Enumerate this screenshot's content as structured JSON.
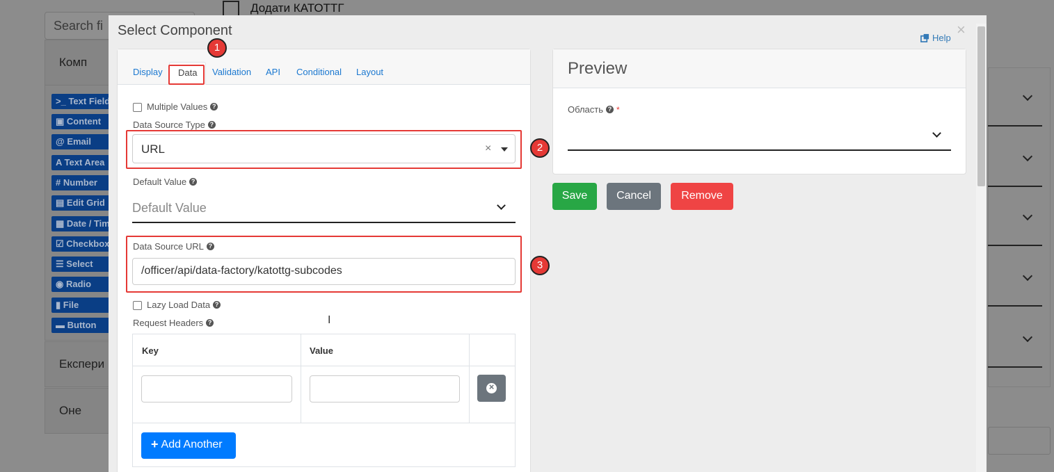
{
  "background": {
    "top_checkbox_label": "Додати КАТОТТГ",
    "search_placeholder": "Search fi",
    "groups": [
      "Комп",
      "Експери",
      "Оне"
    ],
    "components": [
      {
        "icon": ">_",
        "label": "Text Field"
      },
      {
        "icon": "▣",
        "label": "Content"
      },
      {
        "icon": "@",
        "label": "Email"
      },
      {
        "icon": "A",
        "label": "Text Area"
      },
      {
        "icon": "#",
        "label": "Number"
      },
      {
        "icon": "▤",
        "label": "Edit Grid"
      },
      {
        "icon": "▦",
        "label": "Date / Time"
      },
      {
        "icon": "☑",
        "label": "Checkbox"
      },
      {
        "icon": "☰",
        "label": "Select"
      },
      {
        "icon": "◉",
        "label": "Radio"
      },
      {
        "icon": "▮",
        "label": "File"
      },
      {
        "icon": "▬",
        "label": "Button"
      }
    ]
  },
  "modal": {
    "title": "Select Component",
    "close": "×",
    "help": "Help",
    "tabs": [
      "Display",
      "Data",
      "Validation",
      "API",
      "Conditional",
      "Layout"
    ],
    "active_tab": "Data",
    "fields": {
      "multiple_values": "Multiple Values",
      "data_source_type_label": "Data Source Type",
      "data_source_type_value": "URL",
      "select_clear": "×",
      "default_value_label": "Default Value",
      "default_value_placeholder": "Default Value",
      "data_source_url_label": "Data Source URL",
      "data_source_url_value": "/officer/api/data-factory/katottg-subcodes",
      "lazy_load": "Lazy Load Data",
      "request_headers_label": "Request Headers"
    },
    "headers_table": {
      "columns": [
        "Key",
        "Value"
      ],
      "add_another": "Add Another"
    },
    "preview": {
      "title": "Preview",
      "field_label": "Область",
      "required_mark": "*"
    },
    "buttons": {
      "save": "Save",
      "cancel": "Cancel",
      "remove": "Remove"
    },
    "colors": {
      "save": "#28a745",
      "cancel": "#6c757d",
      "remove": "#ef4444",
      "primary": "#007bff",
      "highlight": "#e53935"
    }
  },
  "annotations": {
    "badges": [
      "1",
      "2",
      "3"
    ]
  }
}
